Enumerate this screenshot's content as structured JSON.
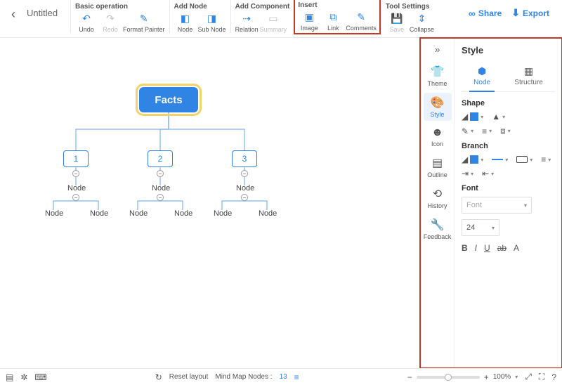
{
  "doc": {
    "title": "Untitled"
  },
  "toolbar": {
    "Basic_operation": {
      "title": "Basic operation",
      "undo": "Undo",
      "redo": "Redo",
      "format_painter": "Format Painter"
    },
    "Add_Node": {
      "title": "Add Node",
      "node": "Node",
      "sub": "Sub Node"
    },
    "Add_Component": {
      "title": "Add Component",
      "relation": "Relation",
      "summary": "Summary"
    },
    "Insert": {
      "title": "Insert",
      "image": "Image",
      "link": "Link",
      "comments": "Comments"
    },
    "Tool_Settings": {
      "title": "Tool Settings",
      "save": "Save",
      "collapse": "Collapse"
    }
  },
  "top_right": {
    "share": "Share",
    "export": "Export"
  },
  "mindmap": {
    "root": "Facts",
    "l1": [
      "1",
      "2",
      "3"
    ],
    "l2_label": "Node"
  },
  "rail": {
    "items": [
      {
        "icon": "👕",
        "label": "Theme"
      },
      {
        "icon": "🎨",
        "label": "Style"
      },
      {
        "icon": "☻",
        "label": "Icon"
      },
      {
        "icon": "▤",
        "label": "Outline"
      },
      {
        "icon": "⟲",
        "label": "History"
      },
      {
        "icon": "🔧",
        "label": "Feedback"
      }
    ]
  },
  "panel": {
    "title": "Style",
    "tabs": {
      "node": "Node",
      "structure": "Structure"
    },
    "sections": {
      "shape": "Shape",
      "branch": "Branch",
      "font": "Font"
    },
    "font_placeholder": "Font",
    "font_size": "24"
  },
  "bottom": {
    "reset": "Reset layout",
    "nodes_label": "Mind Map Nodes :",
    "nodes_count": "13",
    "zoom": "100%"
  }
}
